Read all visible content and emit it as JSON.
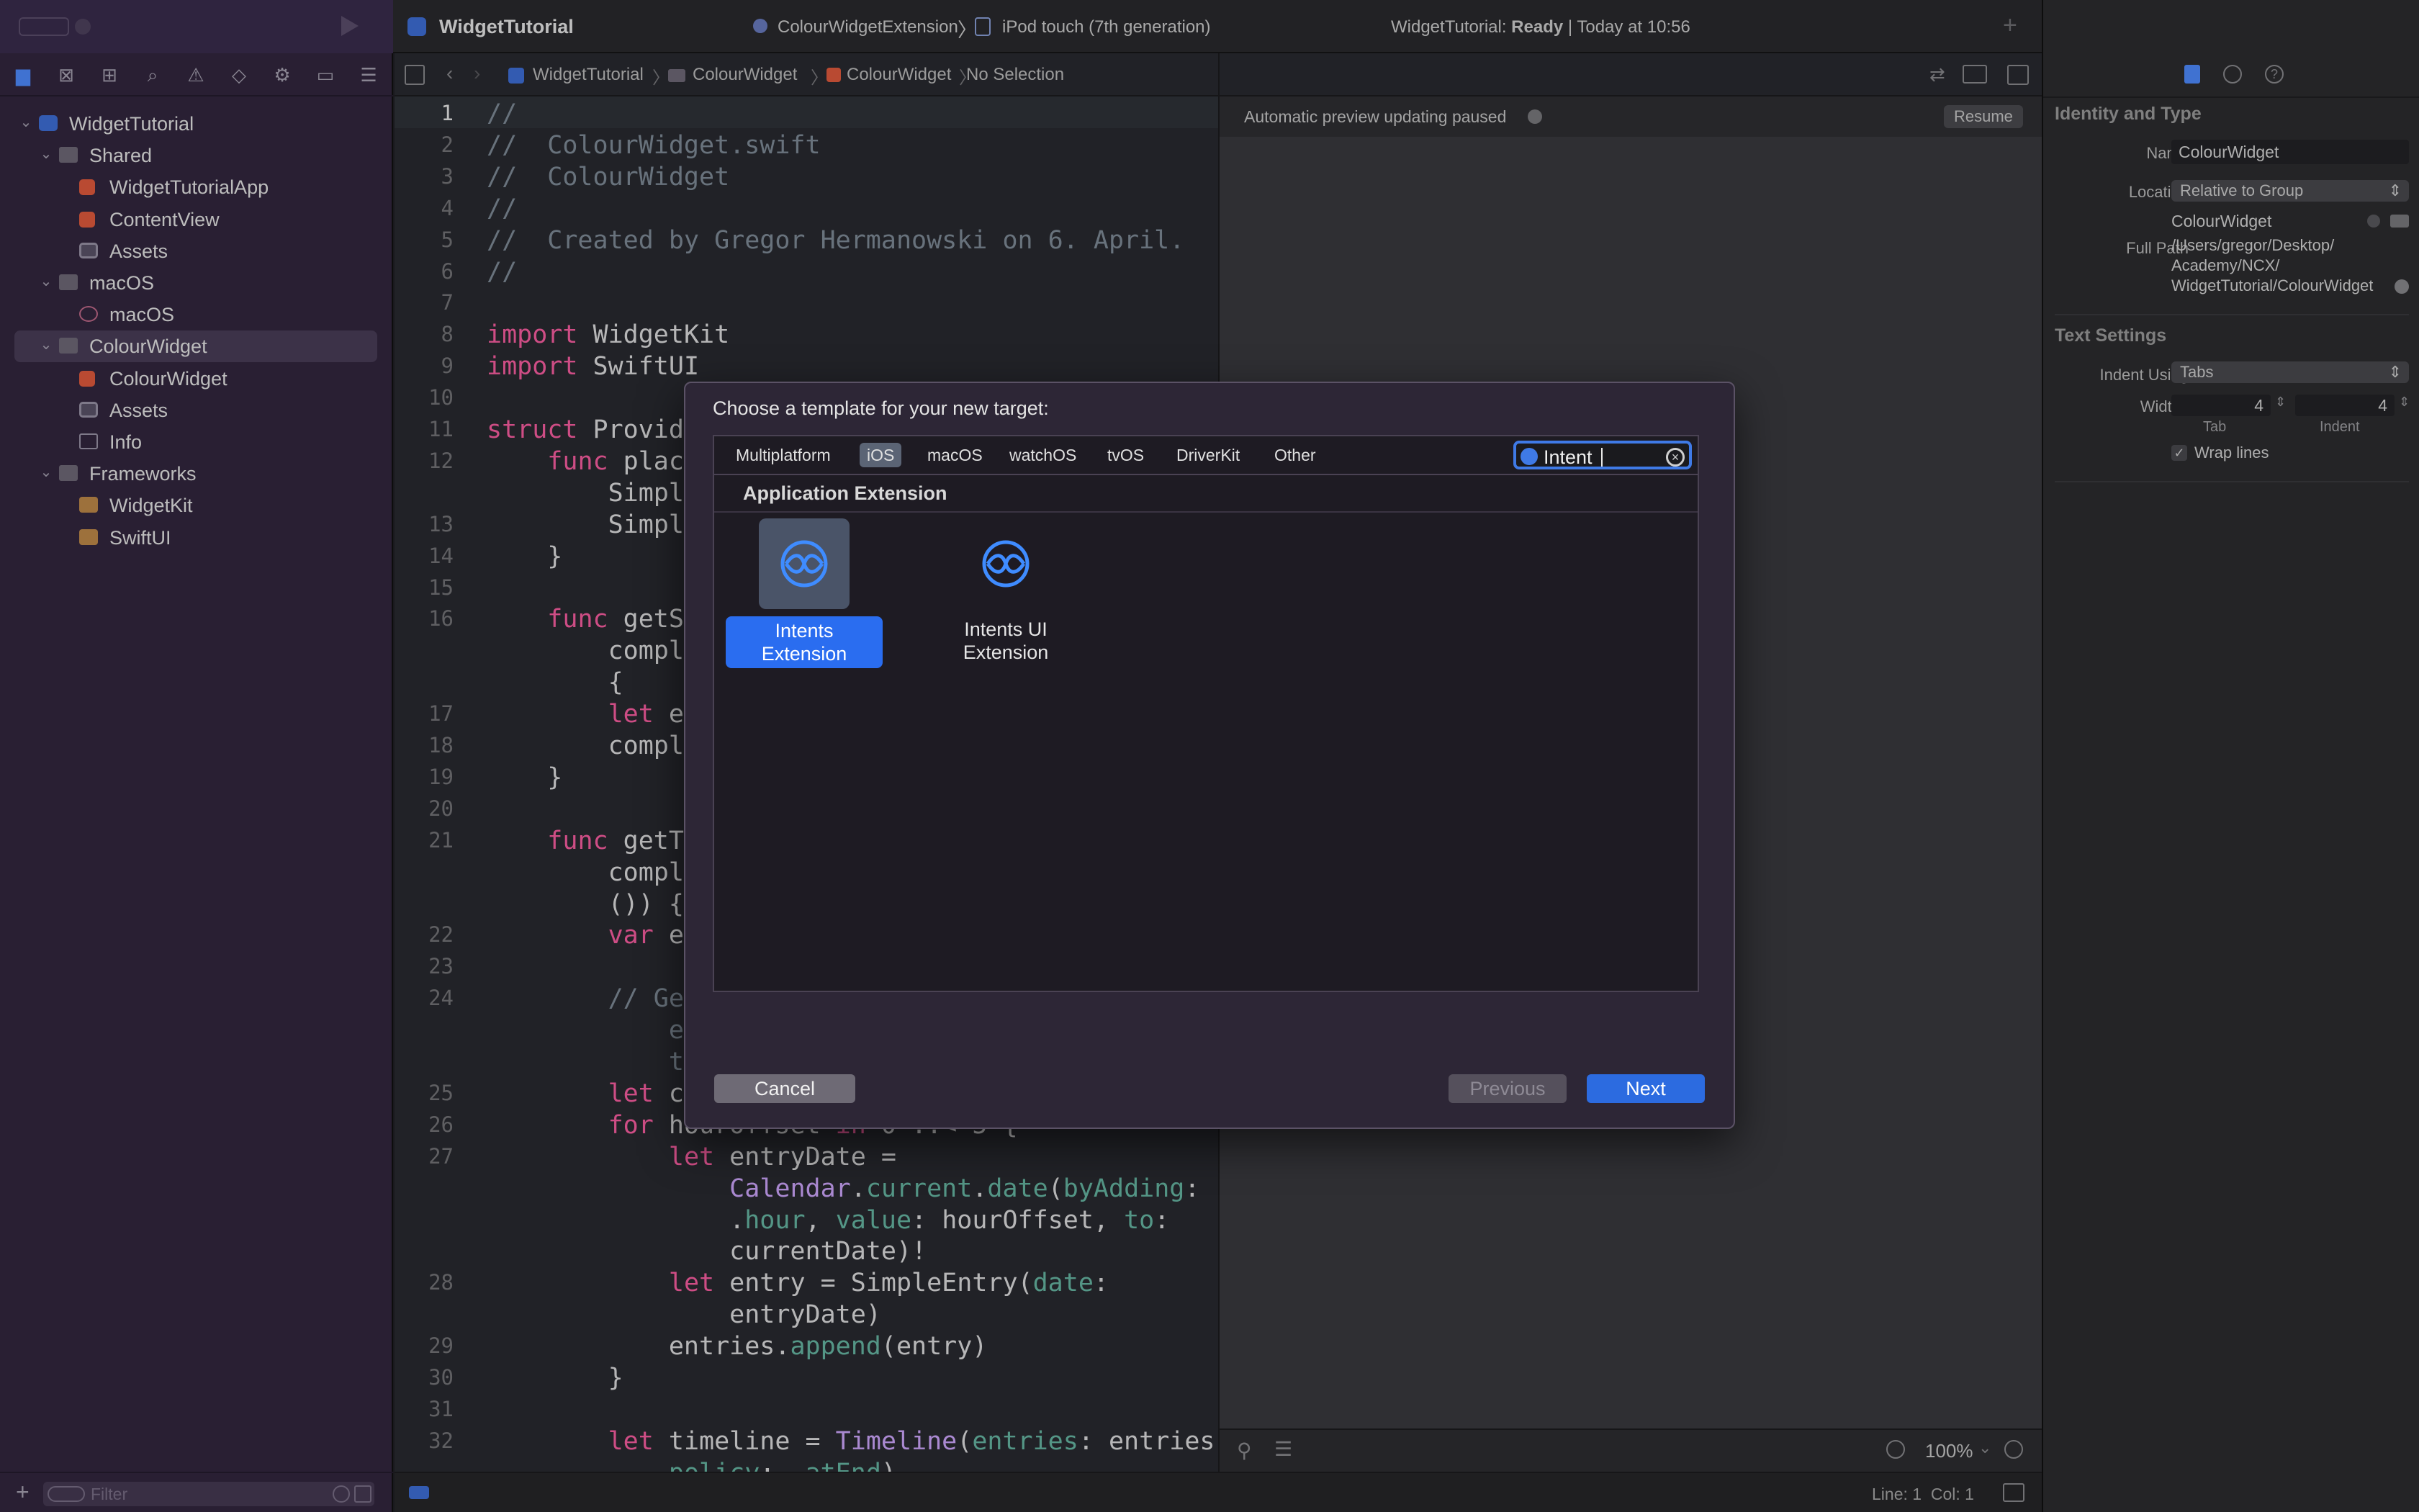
{
  "toolbar": {
    "project_name": "WidgetTutorial",
    "scheme": "ColourWidgetExtension",
    "device": "iPod touch (7th generation)",
    "status_prefix": "WidgetTutorial: ",
    "status_state": "Ready",
    "status_time": "| Today at 10:56"
  },
  "navigator": {
    "filter_placeholder": "Filter",
    "tree": [
      {
        "label": "WidgetTutorial",
        "level": 0,
        "icon": "project-icon",
        "disclosure": true
      },
      {
        "label": "Shared",
        "level": 1,
        "icon": "folder-icon",
        "disclosure": true
      },
      {
        "label": "WidgetTutorialApp",
        "level": 2,
        "icon": "swift-file-icon"
      },
      {
        "label": "ContentView",
        "level": 2,
        "icon": "swift-file-icon"
      },
      {
        "label": "Assets",
        "level": 2,
        "icon": "asset-catalog-icon"
      },
      {
        "label": "macOS",
        "level": 1,
        "icon": "folder-icon",
        "disclosure": true
      },
      {
        "label": "macOS",
        "level": 2,
        "icon": "entitlements-icon"
      },
      {
        "label": "ColourWidget",
        "level": 1,
        "icon": "folder-icon",
        "disclosure": true,
        "selected": true
      },
      {
        "label": "ColourWidget",
        "level": 2,
        "icon": "swift-file-icon"
      },
      {
        "label": "Assets",
        "level": 2,
        "icon": "asset-catalog-icon"
      },
      {
        "label": "Info",
        "level": 2,
        "icon": "plist-icon"
      },
      {
        "label": "Frameworks",
        "level": 1,
        "icon": "folder-icon",
        "disclosure": true
      },
      {
        "label": "WidgetKit",
        "level": 2,
        "icon": "framework-icon"
      },
      {
        "label": "SwiftUI",
        "level": 2,
        "icon": "framework-icon"
      }
    ]
  },
  "jumpbar": {
    "crumbs": [
      "WidgetTutorial",
      "ColourWidget",
      "ColourWidget",
      "No Selection"
    ]
  },
  "editor": {
    "lines": [
      {
        "n": "1",
        "html": "<span class='cm'>//</span>"
      },
      {
        "n": "2",
        "html": "<span class='cm'>//  ColourWidget.swift</span>"
      },
      {
        "n": "3",
        "html": "<span class='cm'>//  ColourWidget</span>"
      },
      {
        "n": "4",
        "html": "<span class='cm'>//</span>"
      },
      {
        "n": "5",
        "html": "<span class='cm'>//  Created by Gregor Hermanowski on 6. April.</span>"
      },
      {
        "n": "6",
        "html": "<span class='cm'>//</span>"
      },
      {
        "n": "7",
        "html": ""
      },
      {
        "n": "8",
        "html": "<span class='kw'>import</span> WidgetKit"
      },
      {
        "n": "9",
        "html": "<span class='kw'>import</span> SwiftUI"
      },
      {
        "n": "10",
        "html": ""
      },
      {
        "n": "11",
        "html": "<span class='kw'>struct</span> Provide"
      },
      {
        "n": "12",
        "html": "    <span class='kw'>func</span> place"
      },
      {
        "n": "",
        "html": "        Simple"
      },
      {
        "n": "13",
        "html": "        Simple"
      },
      {
        "n": "14",
        "html": "    }"
      },
      {
        "n": "15",
        "html": ""
      },
      {
        "n": "16",
        "html": "    <span class='kw'>func</span> getSn"
      },
      {
        "n": "",
        "html": "        comple"
      },
      {
        "n": "",
        "html": "        {"
      },
      {
        "n": "17",
        "html": "        <span class='kw'>let</span> en"
      },
      {
        "n": "18",
        "html": "        comple"
      },
      {
        "n": "19",
        "html": "    }"
      },
      {
        "n": "20",
        "html": ""
      },
      {
        "n": "21",
        "html": "    <span class='kw'>func</span> getTi"
      },
      {
        "n": "",
        "html": "        comple"
      },
      {
        "n": "",
        "html": "        ()) {"
      },
      {
        "n": "22",
        "html": "        <span class='kw'>var</span> en"
      },
      {
        "n": "23",
        "html": ""
      },
      {
        "n": "24",
        "html": "        <span class='cm'>// Gen</span>"
      },
      {
        "n": "",
        "html": "            <span class='cm'>en</span>"
      },
      {
        "n": "",
        "html": "            <span class='cm'>th</span>"
      },
      {
        "n": "25",
        "html": "        <span class='kw'>let</span> cu"
      },
      {
        "n": "26",
        "html": "        <span class='kw'>for</span> hourOffset <span class='kw'>in</span> 0 ..< 5 {"
      },
      {
        "n": "27",
        "html": "            <span class='kw'>let</span> entryDate ="
      },
      {
        "n": "",
        "html": "                <span class='ty'>Calendar</span>.<span class='fn'>current</span>.<span class='fn'>date</span>(<span class='fn'>byAdding</span>:"
      },
      {
        "n": "",
        "html": "                .<span class='fn'>hour</span>, <span class='fn'>value</span>: hourOffset, <span class='fn'>to</span>:"
      },
      {
        "n": "",
        "html": "                currentDate)!"
      },
      {
        "n": "28",
        "html": "            <span class='kw'>let</span> entry = SimpleEntry(<span class='fn'>date</span>:"
      },
      {
        "n": "",
        "html": "                entryDate)"
      },
      {
        "n": "29",
        "html": "            entries.<span class='fn'>append</span>(entry)"
      },
      {
        "n": "30",
        "html": "        }"
      },
      {
        "n": "31",
        "html": ""
      },
      {
        "n": "32",
        "html": "        <span class='kw'>let</span> timeline = <span class='ty'>Timeline</span>(<span class='fn'>entries</span>: entries,"
      },
      {
        "n": "",
        "html": "            <span class='fn'>policy</span>: .<span class='fn'>atEnd</span>)"
      }
    ]
  },
  "canvas": {
    "paused_text": "Automatic preview updating paused",
    "resume_label": "Resume",
    "zoom": "100%"
  },
  "inspector": {
    "identity_header": "Identity and Type",
    "name_label": "Name",
    "name_value": "ColourWidget",
    "location_label": "Location",
    "location_value": "Relative to Group",
    "location_file": "ColourWidget",
    "fullpath_label": "Full Path",
    "fullpath_lines": [
      "/Users/gregor/Desktop/",
      "Academy/NCX/",
      "WidgetTutorial/ColourWidget"
    ],
    "text_settings_header": "Text Settings",
    "indent_label": "Indent Using",
    "indent_value": "Tabs",
    "widths_label": "Widths",
    "tab_value": "4",
    "tab_caption": "Tab",
    "indent_width_value": "4",
    "indent_caption": "Indent",
    "wrap_label": "Wrap lines"
  },
  "statusbar": {
    "position": "Line: 1  Col: 1"
  },
  "modal": {
    "title": "Choose a template for your new target:",
    "tabs": [
      "Multiplatform",
      "iOS",
      "macOS",
      "watchOS",
      "tvOS",
      "DriverKit",
      "Other"
    ],
    "active_tab": "iOS",
    "search_value": "Intent",
    "section_title": "Application Extension",
    "templates": [
      {
        "label": "Intents Extension",
        "selected": true
      },
      {
        "label": "Intents UI\nExtension",
        "selected": false
      }
    ],
    "cancel_label": "Cancel",
    "previous_label": "Previous",
    "next_label": "Next"
  },
  "colors": {
    "accent": "#2c6be0",
    "sidebar": "#33273f",
    "editor_bg": "#292a30",
    "keyword": "#fc5fa3",
    "comment": "#7f8c98"
  }
}
